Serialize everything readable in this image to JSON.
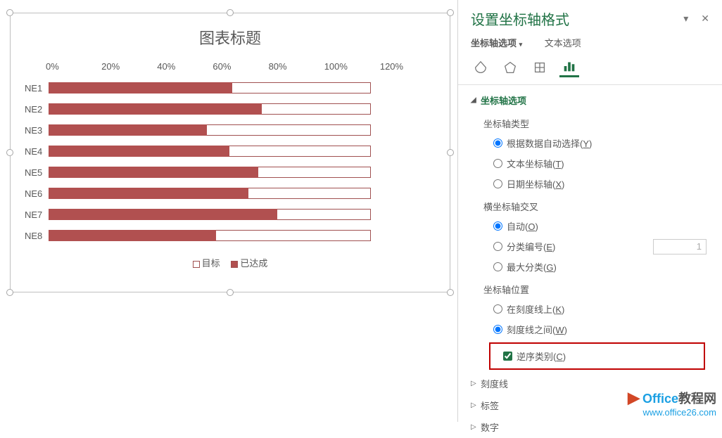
{
  "chart_data": {
    "type": "bar",
    "title": "图表标题",
    "xlabel": "",
    "ylabel": "",
    "xlim": [
      0,
      1.2
    ],
    "x_ticks": [
      "0%",
      "20%",
      "40%",
      "60%",
      "80%",
      "100%",
      "120%"
    ],
    "categories": [
      "NE1",
      "NE2",
      "NE3",
      "NE4",
      "NE5",
      "NE6",
      "NE7",
      "NE8"
    ],
    "series": [
      {
        "name": "目标",
        "values": [
          1.0,
          1.0,
          1.0,
          1.0,
          1.0,
          1.0,
          1.0,
          1.0
        ]
      },
      {
        "name": "已达成",
        "values": [
          0.57,
          0.66,
          0.49,
          0.56,
          0.65,
          0.62,
          0.71,
          0.52
        ]
      }
    ],
    "legend": [
      "目标",
      "已达成"
    ]
  },
  "panel": {
    "title": "设置坐标轴格式",
    "close_icon": "✕",
    "dropdown_icon": "▾",
    "tabs": {
      "axis_options": "坐标轴选项",
      "text_options": "文本选项"
    },
    "sections": {
      "axis_options": {
        "title": "坐标轴选项",
        "axis_type_label": "坐标轴类型",
        "axis_type_auto": "根据数据自动选择(Y)",
        "axis_type_text": "文本坐标轴(T)",
        "axis_type_date": "日期坐标轴(X)",
        "cross_label": "横坐标轴交叉",
        "cross_auto": "自动(O)",
        "cross_category": "分类编号(E)",
        "cross_category_value": "1",
        "cross_max": "最大分类(G)",
        "position_label": "坐标轴位置",
        "position_on": "在刻度线上(K)",
        "position_between": "刻度线之间(W)",
        "reverse": "逆序类别(C)"
      },
      "tickmarks": "刻度线",
      "labels": "标签",
      "numbers": "数字"
    }
  },
  "watermark": {
    "brand1": "Office",
    "brand2": "教程网",
    "url": "www.office26.com"
  }
}
